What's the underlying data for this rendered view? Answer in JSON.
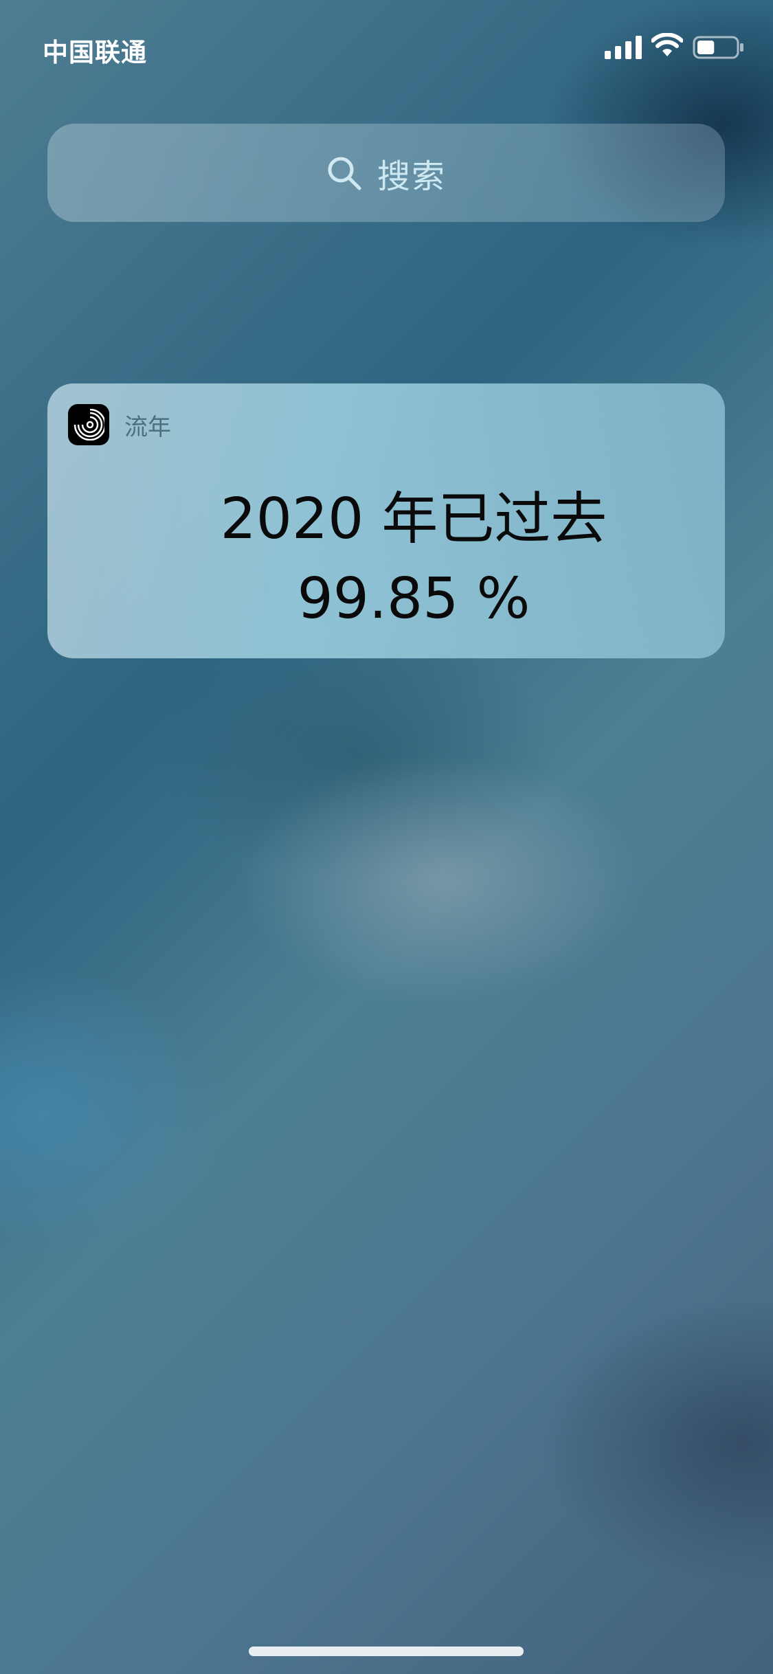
{
  "status_bar": {
    "carrier": "中国联通",
    "signal_icon": "cellular-signal-icon",
    "wifi_icon": "wifi-icon",
    "battery_icon": "battery-icon",
    "battery_level": 0.45
  },
  "search": {
    "placeholder": "搜索",
    "icon": "search-icon"
  },
  "widget": {
    "app_name": "流年",
    "app_icon": "spiral-icon",
    "line1": "2020 年已过去",
    "line2": "99.85 %"
  },
  "colors": {
    "text_primary": "#0a0a0a",
    "status_text": "#ffffff",
    "search_text": "#cfe9f3"
  }
}
